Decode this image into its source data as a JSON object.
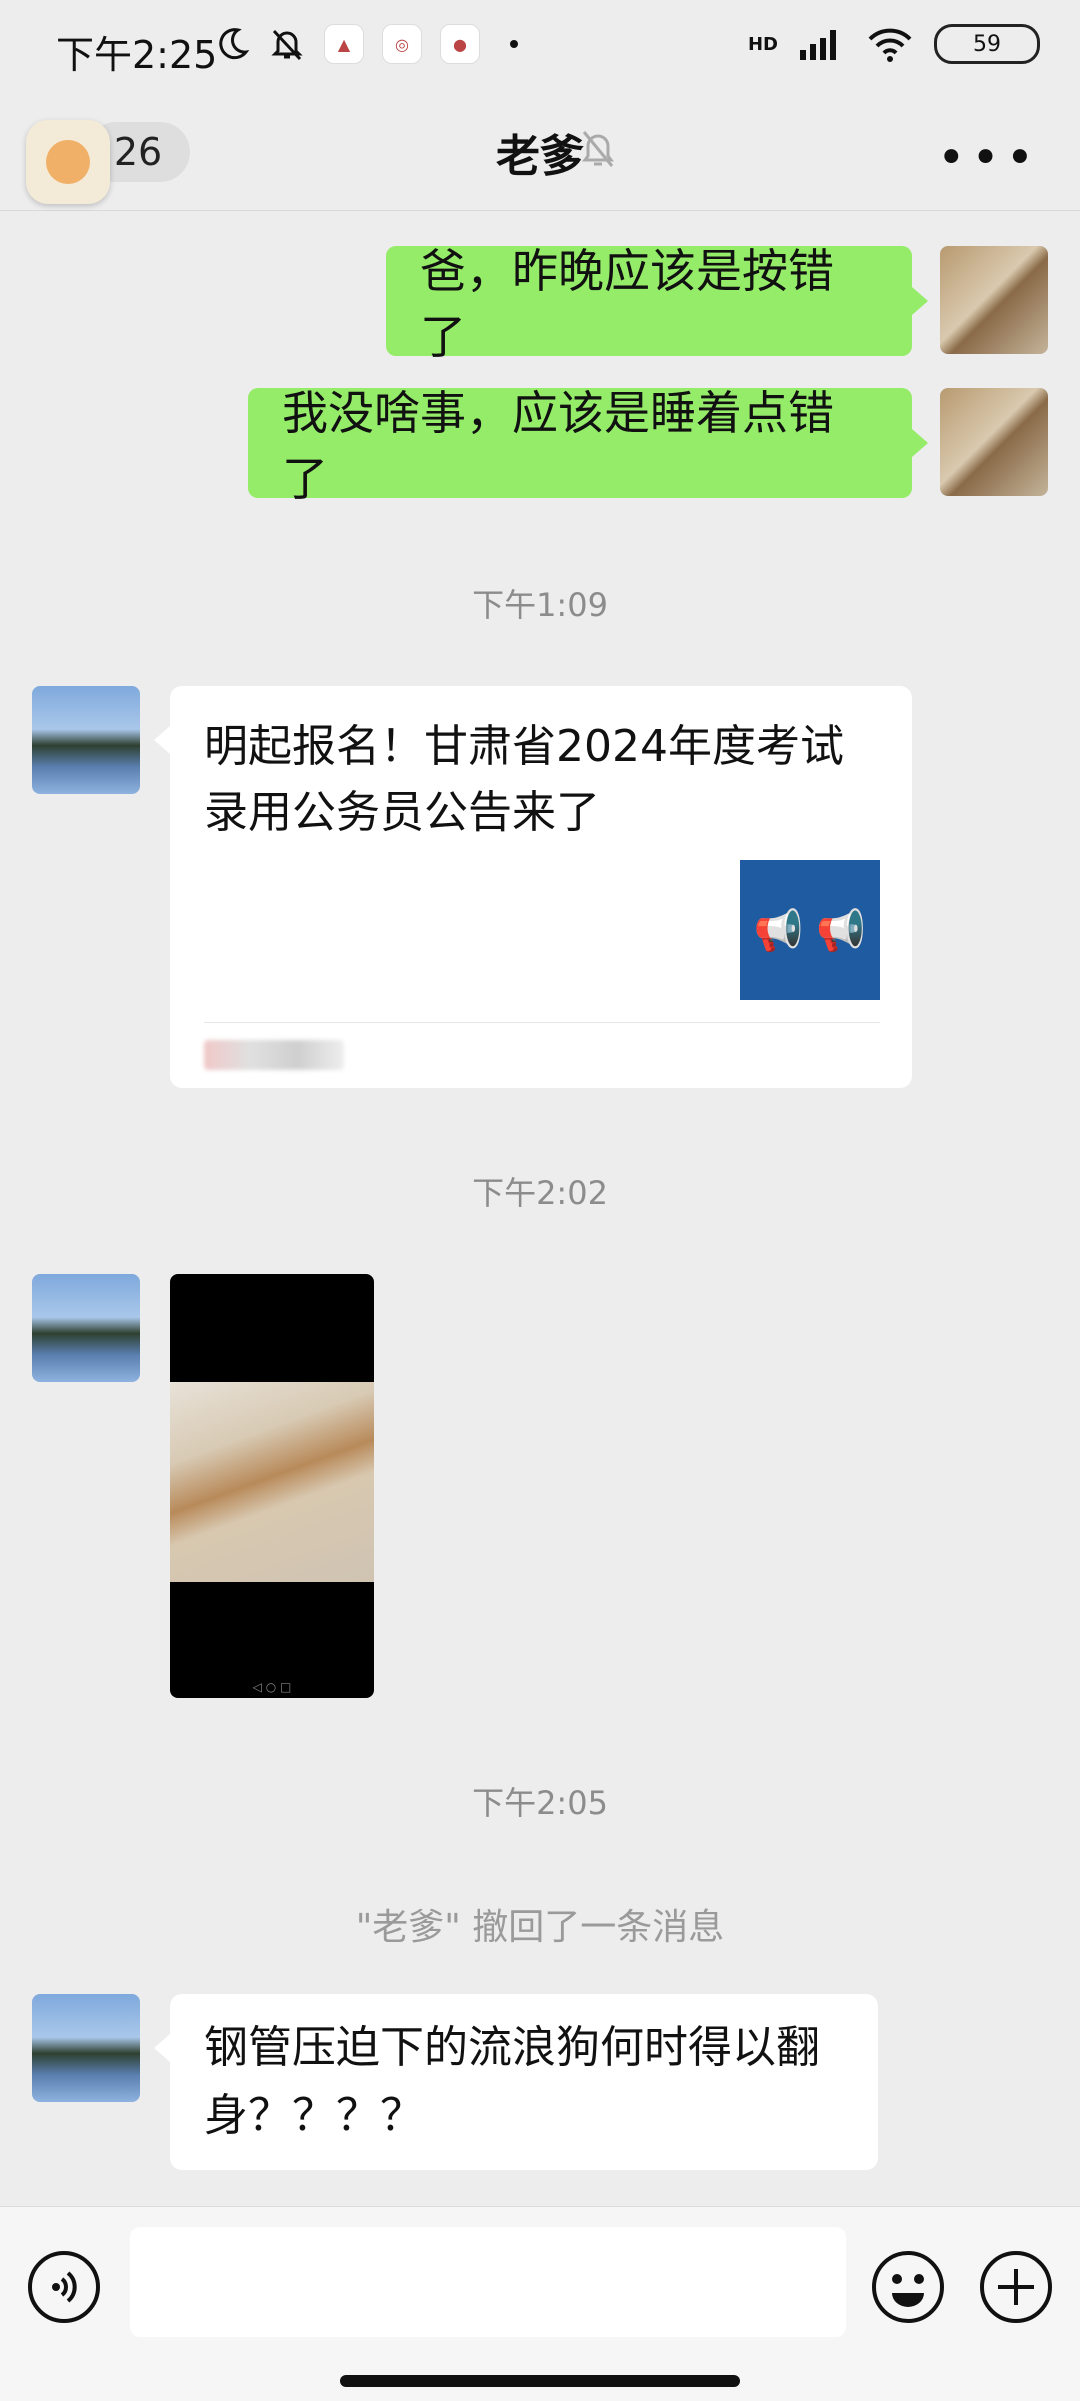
{
  "status_bar": {
    "time": "下午2:25",
    "network": "HD",
    "battery": "59"
  },
  "header": {
    "unread_count": "26",
    "title": "老爹"
  },
  "messages": {
    "sent1": "爸，昨晚应该是按错了",
    "sent2": "我没啥事，应该是睡着点错了",
    "time1": "下午1:09",
    "article_title": "明起报名！甘肃省2024年度考试录用公务员公告来了",
    "article_thumb_emoji": "📢 📢",
    "time2": "下午2:02",
    "time3": "下午2:05",
    "recall_notice": "\"老爹\" 撤回了一条消息",
    "received_text": "钢管压迫下的流浪狗何时得以翻身？？？？"
  },
  "icons": {
    "back": "chevron-left-icon",
    "mute": "bell-off-icon",
    "more": "more-icon",
    "voice": "voice-icon",
    "emoji": "emoji-icon",
    "add": "plus-icon"
  },
  "colors": {
    "background": "#ededed",
    "sent_bubble": "#95ec69",
    "received_bubble": "#ffffff"
  }
}
